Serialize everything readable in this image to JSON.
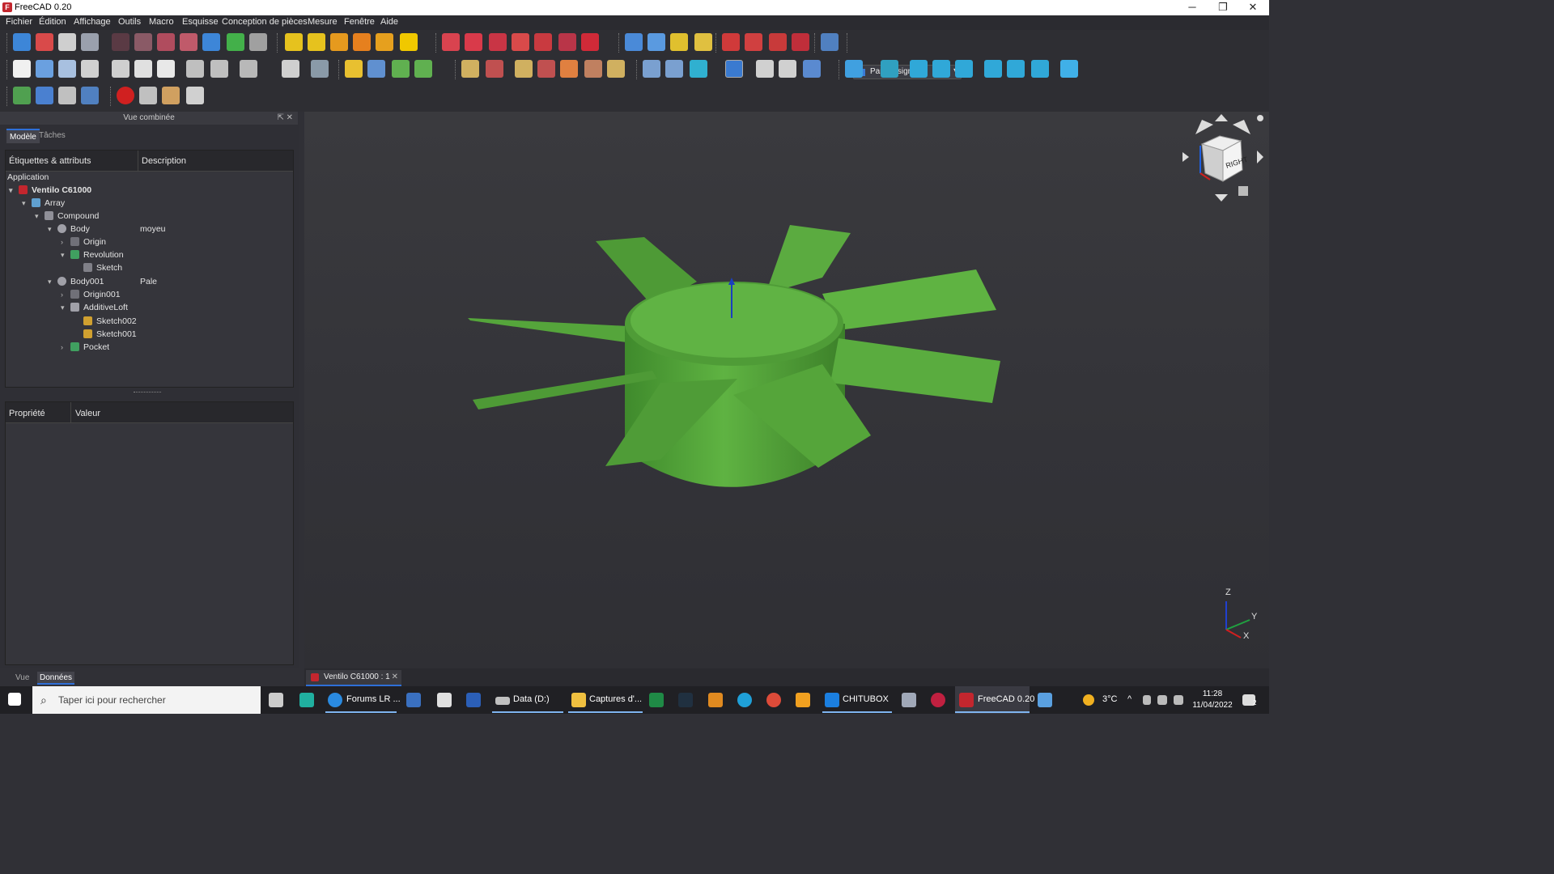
{
  "window": {
    "title": "FreeCAD 0.20",
    "min_glyph": "─",
    "max_glyph": "❐",
    "close_glyph": "✕"
  },
  "menu": [
    "Fichier",
    "Édition",
    "Affichage",
    "Outils",
    "Macro",
    "Esquisse",
    "Conception de pièces",
    "Mesure",
    "Fenêtre",
    "Aide"
  ],
  "workbench": {
    "selected": "Part Design",
    "arrow": "▾"
  },
  "combo_view": {
    "title": "Vue combinée",
    "controls": "⇱ ✕",
    "tabs": [
      "Modèle",
      "Tâches"
    ],
    "tree_headers": {
      "labels": "Étiquettes & attributs",
      "description": "Description"
    },
    "tree_rows": [
      {
        "label": "Application",
        "desc": ""
      },
      {
        "label": "Ventilo C61000",
        "desc": ""
      },
      {
        "label": "Array",
        "desc": ""
      },
      {
        "label": "Compound",
        "desc": ""
      },
      {
        "label": "Body",
        "desc": "moyeu"
      },
      {
        "label": "Origin",
        "desc": ""
      },
      {
        "label": "Revolution",
        "desc": ""
      },
      {
        "label": "Sketch",
        "desc": ""
      },
      {
        "label": "Body001",
        "desc": "Pale"
      },
      {
        "label": "Origin001",
        "desc": ""
      },
      {
        "label": "AdditiveLoft",
        "desc": ""
      },
      {
        "label": "Sketch002",
        "desc": ""
      },
      {
        "label": "Sketch001",
        "desc": ""
      },
      {
        "label": "Pocket",
        "desc": ""
      }
    ],
    "prop_headers": {
      "property": "Propriété",
      "value": "Valeur"
    },
    "bottom_tabs": [
      "Vue",
      "Données"
    ]
  },
  "navcube": {
    "face": "RIGHT"
  },
  "axes": {
    "z": "Z",
    "y": "Y",
    "x": "X"
  },
  "document_tab": {
    "label": "Ventilo C61000 : 1",
    "close": "✕"
  },
  "taskbar": {
    "search_placeholder": "Taper ici pour rechercher",
    "search_glyph": "⌕",
    "apps": [
      "Forums LR ...",
      "Data (D:)",
      "Captures d'...",
      "CHITUBOX",
      "FreeCAD 0.20"
    ],
    "weather": "3°C",
    "time": "11:28",
    "date": "11/04/2022",
    "notification_count": "2"
  },
  "colors": {
    "model_green": "#5da83e",
    "accent": "#2e6fd8",
    "viewport_bg": "#38383c"
  }
}
